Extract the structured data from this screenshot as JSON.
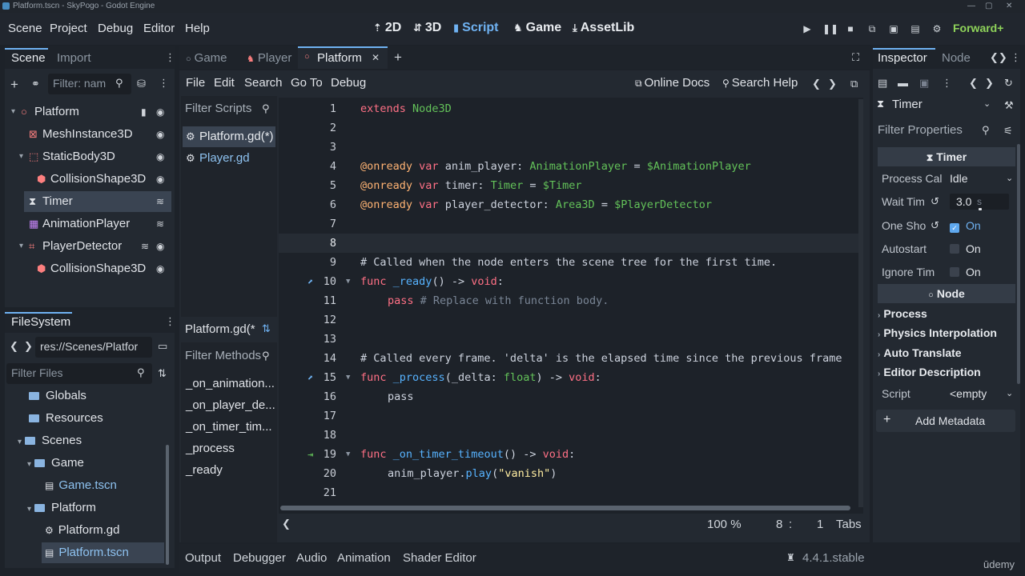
{
  "titlebar": {
    "title": "Platform.tscn - SkyPogo - Godot Engine"
  },
  "menu": [
    "Scene",
    "Project",
    "Debug",
    "Editor",
    "Help"
  ],
  "workspaces": [
    {
      "label": "2D",
      "icon": "⇡"
    },
    {
      "label": "3D",
      "icon": "⇵"
    },
    {
      "label": "Script",
      "icon": "▮"
    },
    {
      "label": "Game",
      "icon": "♞"
    },
    {
      "label": "AssetLib",
      "icon": "⤓"
    }
  ],
  "renderer": "Forward+",
  "scene_dock": {
    "tabs": [
      "Scene",
      "Import"
    ],
    "filter_placeholder": "Filter: nam",
    "nodes": [
      {
        "label": "Platform",
        "icon_color": "#fc7f7f",
        "icon": "○"
      },
      {
        "label": "MeshInstance3D",
        "icon_color": "#fc7f7f",
        "icon": "⊠"
      },
      {
        "label": "StaticBody3D",
        "icon_color": "#fc7f7f",
        "icon": "⬚"
      },
      {
        "label": "CollisionShape3D",
        "icon_color": "#fc7f7f",
        "icon": "⬢"
      },
      {
        "label": "Timer",
        "icon_color": "#e0e3e8",
        "icon": "⧗"
      },
      {
        "label": "AnimationPlayer",
        "icon_color": "#c584f7",
        "icon": "▦"
      },
      {
        "label": "PlayerDetector",
        "icon_color": "#fc7f7f",
        "icon": "⌗"
      },
      {
        "label": "CollisionShape3D",
        "icon_color": "#fc7f7f",
        "icon": "⬢"
      }
    ]
  },
  "filesystem": {
    "title": "FileSystem",
    "path": "res://Scenes/Platfor",
    "filter_placeholder": "Filter Files",
    "items": [
      {
        "label": "Globals",
        "type": "folder"
      },
      {
        "label": "Resources",
        "type": "folder"
      },
      {
        "label": "Scenes",
        "type": "folder"
      },
      {
        "label": "Game",
        "type": "folder"
      },
      {
        "label": "Game.tscn",
        "type": "scene"
      },
      {
        "label": "Platform",
        "type": "folder"
      },
      {
        "label": "Platform.gd",
        "type": "script"
      },
      {
        "label": "Platform.tscn",
        "type": "scene"
      }
    ]
  },
  "editor_tabs": [
    {
      "label": "Game"
    },
    {
      "label": "Player"
    },
    {
      "label": "Platform"
    }
  ],
  "script_menu": [
    "File",
    "Edit",
    "Search",
    "Go To",
    "Debug"
  ],
  "online_docs": "Online Docs",
  "search_help": "Search Help",
  "filter_scripts": "Filter Scripts",
  "scripts": [
    "Platform.gd(*)",
    "Player.gd"
  ],
  "current_script": "Platform.gd(*",
  "filter_methods": "Filter Methods",
  "methods": [
    "_on_animation...",
    "_on_player_de...",
    "_on_timer_tim...",
    "_process",
    "_ready"
  ],
  "code": {
    "lines": [
      "1",
      "2",
      "3",
      "4",
      "5",
      "6",
      "7",
      "8",
      "9",
      "10",
      "11",
      "12",
      "13",
      "14",
      "15",
      "16",
      "17",
      "18",
      "19",
      "20",
      "21"
    ],
    "l1a": "extends",
    "l1b": "Node3D",
    "l4a": "@onready",
    "l4b": "var",
    "l4c": "anim_player:",
    "l4d": "AnimationPlayer",
    "l4e": "=",
    "l4f": "$AnimationPlayer",
    "l5a": "@onready",
    "l5b": "var",
    "l5c": "timer:",
    "l5d": "Timer",
    "l5e": "=",
    "l5f": "$Timer",
    "l6a": "@onready",
    "l6b": "var",
    "l6c": "player_detector:",
    "l6d": "Area3D",
    "l6e": "=",
    "l6f": "$PlayerDetector",
    "l9": "# Called when the node enters the scene tree for the first time.",
    "l10a": "func",
    "l10b": "_ready",
    "l10c": "() ->",
    "l10d": "void",
    "l11a": "pass",
    "l11b": "# Replace with function body.",
    "l14": "# Called every frame. 'delta' is the elapsed time since the previous frame",
    "l15a": "func",
    "l15b": "_process",
    "l15c": "(_delta:",
    "l15d": "float",
    "l15e": ") ->",
    "l15f": "void",
    "l16": "pass",
    "l19a": "func",
    "l19b": "_on_timer_timeout",
    "l19c": "() ->",
    "l19d": "void",
    "l20a": "anim_player.",
    "l20b": "play",
    "l20c": "(",
    "l20d": "\"vanish\"",
    "l20e": ")"
  },
  "status": {
    "zoom": "100 %",
    "line": "8",
    "col": "1",
    "indent": "Tabs"
  },
  "bottom_tabs": [
    "Output",
    "Debugger",
    "Audio",
    "Animation",
    "Shader Editor"
  ],
  "version": "4.4.1.stable",
  "watermark": "ūdemy",
  "inspector": {
    "tabs": [
      "Inspector",
      "Node"
    ],
    "object": "Timer",
    "filter_placeholder": "Filter Properties",
    "section_timer": "Timer",
    "props": [
      {
        "label": "Process Cal",
        "value": "Idle"
      },
      {
        "label": "Wait Tim",
        "value": "3.0",
        "unit": "s"
      },
      {
        "label": "One Sho",
        "value": "On",
        "checked": true
      },
      {
        "label": "Autostart",
        "value": "On",
        "checked": false
      },
      {
        "label": "Ignore Tim",
        "value": "On",
        "checked": false
      }
    ],
    "section_node": "Node",
    "groups": [
      "Process",
      "Physics Interpolation",
      "Auto Translate",
      "Editor Description"
    ],
    "script_label": "Script",
    "script_value": "<empty",
    "add_metadata": "Add Metadata"
  }
}
